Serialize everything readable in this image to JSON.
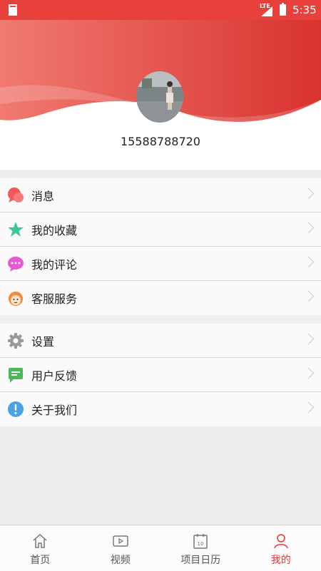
{
  "status_bar": {
    "network": "LTE",
    "time": "5:35"
  },
  "profile": {
    "phone": "15588788720"
  },
  "menu_group_1": [
    {
      "label": "消息",
      "icon": "chat-bubble-icon",
      "color": "#f05a5a"
    },
    {
      "label": "我的收藏",
      "icon": "star-icon",
      "color": "#3cc89a"
    },
    {
      "label": "我的评论",
      "icon": "comment-icon",
      "color": "#e45ad0"
    },
    {
      "label": "客服服务",
      "icon": "service-agent-icon",
      "color": "#f28a38"
    }
  ],
  "menu_group_2": [
    {
      "label": "设置",
      "icon": "gear-icon",
      "color": "#9a9a9a"
    },
    {
      "label": "用户反馈",
      "icon": "feedback-icon",
      "color": "#4cb85c"
    },
    {
      "label": "关于我们",
      "icon": "info-icon",
      "color": "#4aa3e6"
    }
  ],
  "tabs": [
    {
      "label": "首页",
      "icon": "home-icon",
      "active": false
    },
    {
      "label": "视频",
      "icon": "video-icon",
      "active": false
    },
    {
      "label": "项目日历",
      "icon": "calendar-icon",
      "active": false,
      "badge": "10"
    },
    {
      "label": "我的",
      "icon": "person-icon",
      "active": true
    }
  ],
  "colors": {
    "accent": "#e8413c",
    "active_tab": "#e03a3a"
  }
}
